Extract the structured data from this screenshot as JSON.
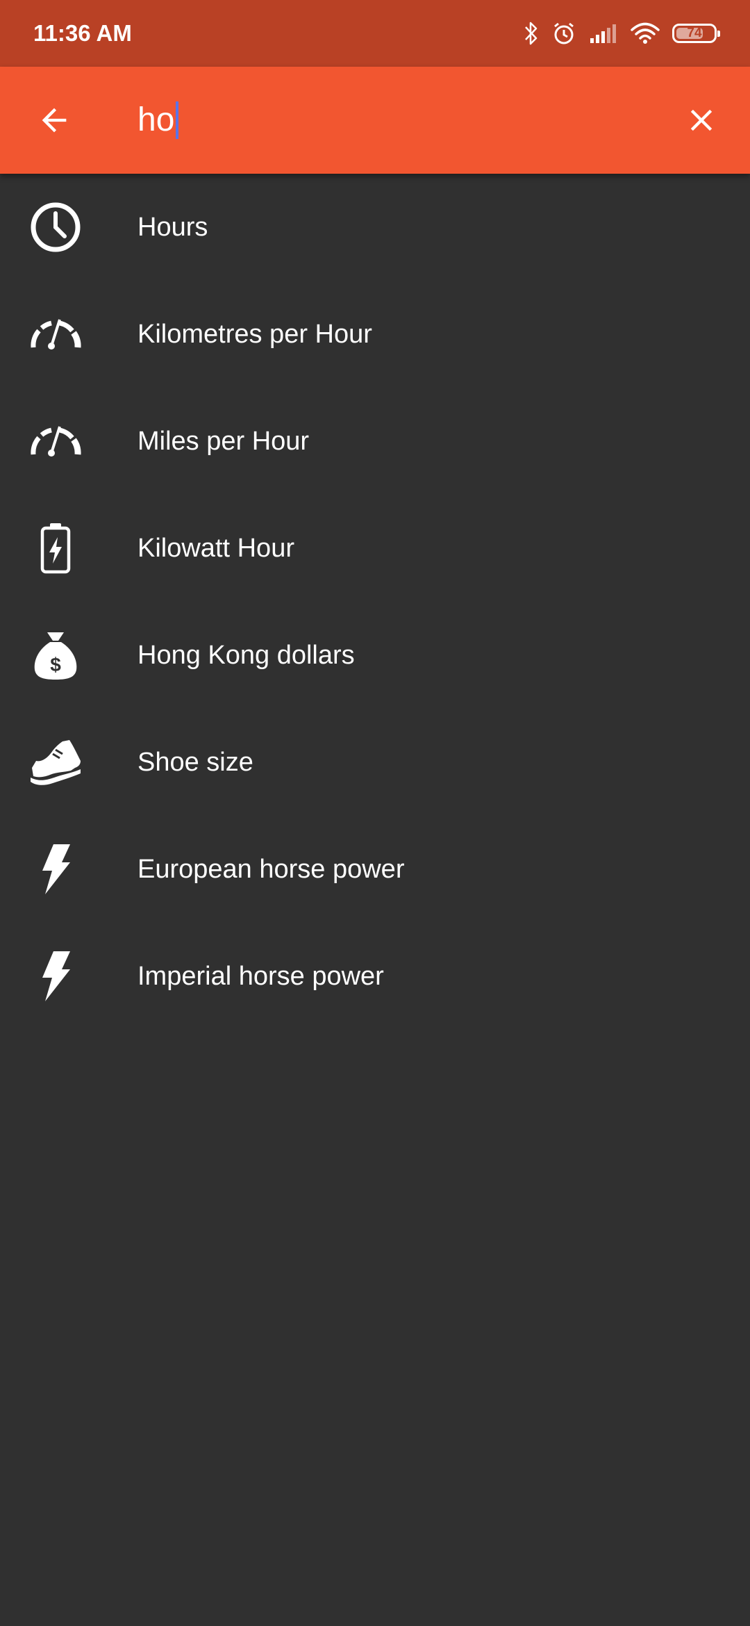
{
  "status_bar": {
    "time": "11:36 AM",
    "battery_level": "74",
    "battery_fraction": 0.74,
    "icons": [
      "bluetooth-icon",
      "alarm-icon",
      "signal-icon",
      "wifi-icon",
      "battery-icon"
    ]
  },
  "search": {
    "value": "ho",
    "back_icon": "arrow-back-icon",
    "clear_icon": "close-icon"
  },
  "results": [
    {
      "label": "Hours",
      "icon": "clock-icon"
    },
    {
      "label": "Kilometres per Hour",
      "icon": "speedometer-icon"
    },
    {
      "label": "Miles per Hour",
      "icon": "speedometer-icon"
    },
    {
      "label": "Kilowatt Hour",
      "icon": "battery-charging-icon"
    },
    {
      "label": "Hong Kong dollars",
      "icon": "money-bag-icon"
    },
    {
      "label": "Shoe size",
      "icon": "sneaker-icon"
    },
    {
      "label": "European horse power",
      "icon": "lightning-icon"
    },
    {
      "label": "Imperial horse power",
      "icon": "lightning-icon"
    }
  ],
  "colors": {
    "status_bar": "#b94125",
    "app_bar": "#f25630",
    "background": "#303030",
    "caret": "#5c73e6",
    "text": "#ffffff"
  }
}
